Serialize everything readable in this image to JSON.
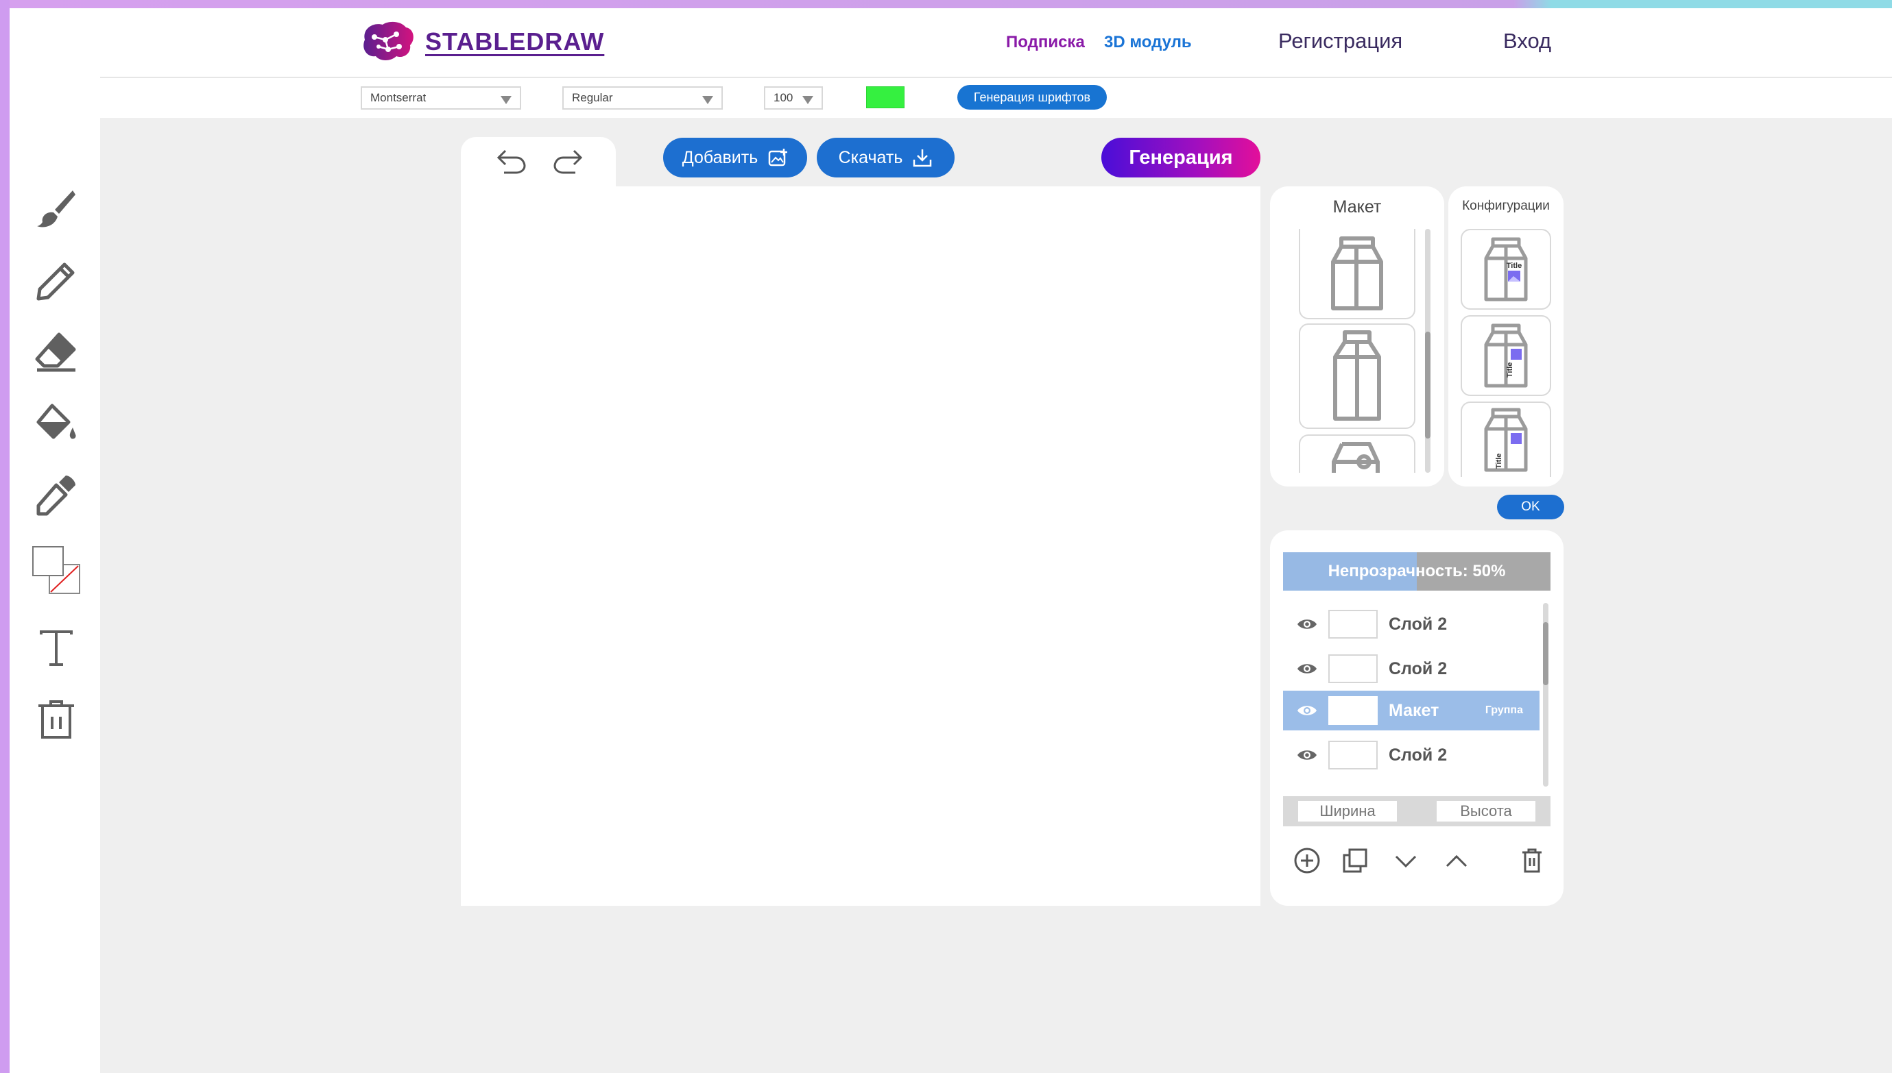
{
  "brand": {
    "name": "STABLEDRAW"
  },
  "nav": {
    "subscription": "Подписка",
    "module_3d": "3D модуль",
    "register": "Регистрация",
    "login": "Вход"
  },
  "font_toolbar": {
    "font_family": "Montserrat",
    "font_weight": "Regular",
    "font_size": "100",
    "color": "#35f040",
    "generate_fonts": "Генерация шрифтов"
  },
  "tools": [
    {
      "name": "brush-icon"
    },
    {
      "name": "pencil-icon"
    },
    {
      "name": "eraser-icon"
    },
    {
      "name": "paint-bucket-icon"
    },
    {
      "name": "eyedropper-icon"
    },
    {
      "name": "color-swap-icon"
    },
    {
      "name": "text-icon"
    },
    {
      "name": "trash-icon"
    }
  ],
  "canvas_toolbar": {
    "add": "Добавить",
    "download": "Скачать",
    "generate": "Генерация"
  },
  "maket_panel": {
    "title": "Макет",
    "thumbnails": [
      "milk-carton-icon",
      "tall-carton-icon",
      "carton-partial-icon"
    ]
  },
  "config_panel": {
    "title": "Конфигурации",
    "thumbnails": [
      {
        "label": "Title"
      },
      {
        "label": "Title"
      },
      {
        "label": "Title"
      }
    ]
  },
  "ok_button": "OK",
  "layers_panel": {
    "opacity_label": "Непрозрачность: 50%",
    "opacity": 0.5,
    "layers": [
      {
        "name": "Слой 2",
        "active": false,
        "tag": ""
      },
      {
        "name": "Слой 2",
        "active": false,
        "tag": ""
      },
      {
        "name": "Макет",
        "active": true,
        "tag": "Группа"
      },
      {
        "name": "Слой 2",
        "active": false,
        "tag": ""
      }
    ],
    "width_placeholder": "Ширина",
    "height_placeholder": "Высота"
  }
}
